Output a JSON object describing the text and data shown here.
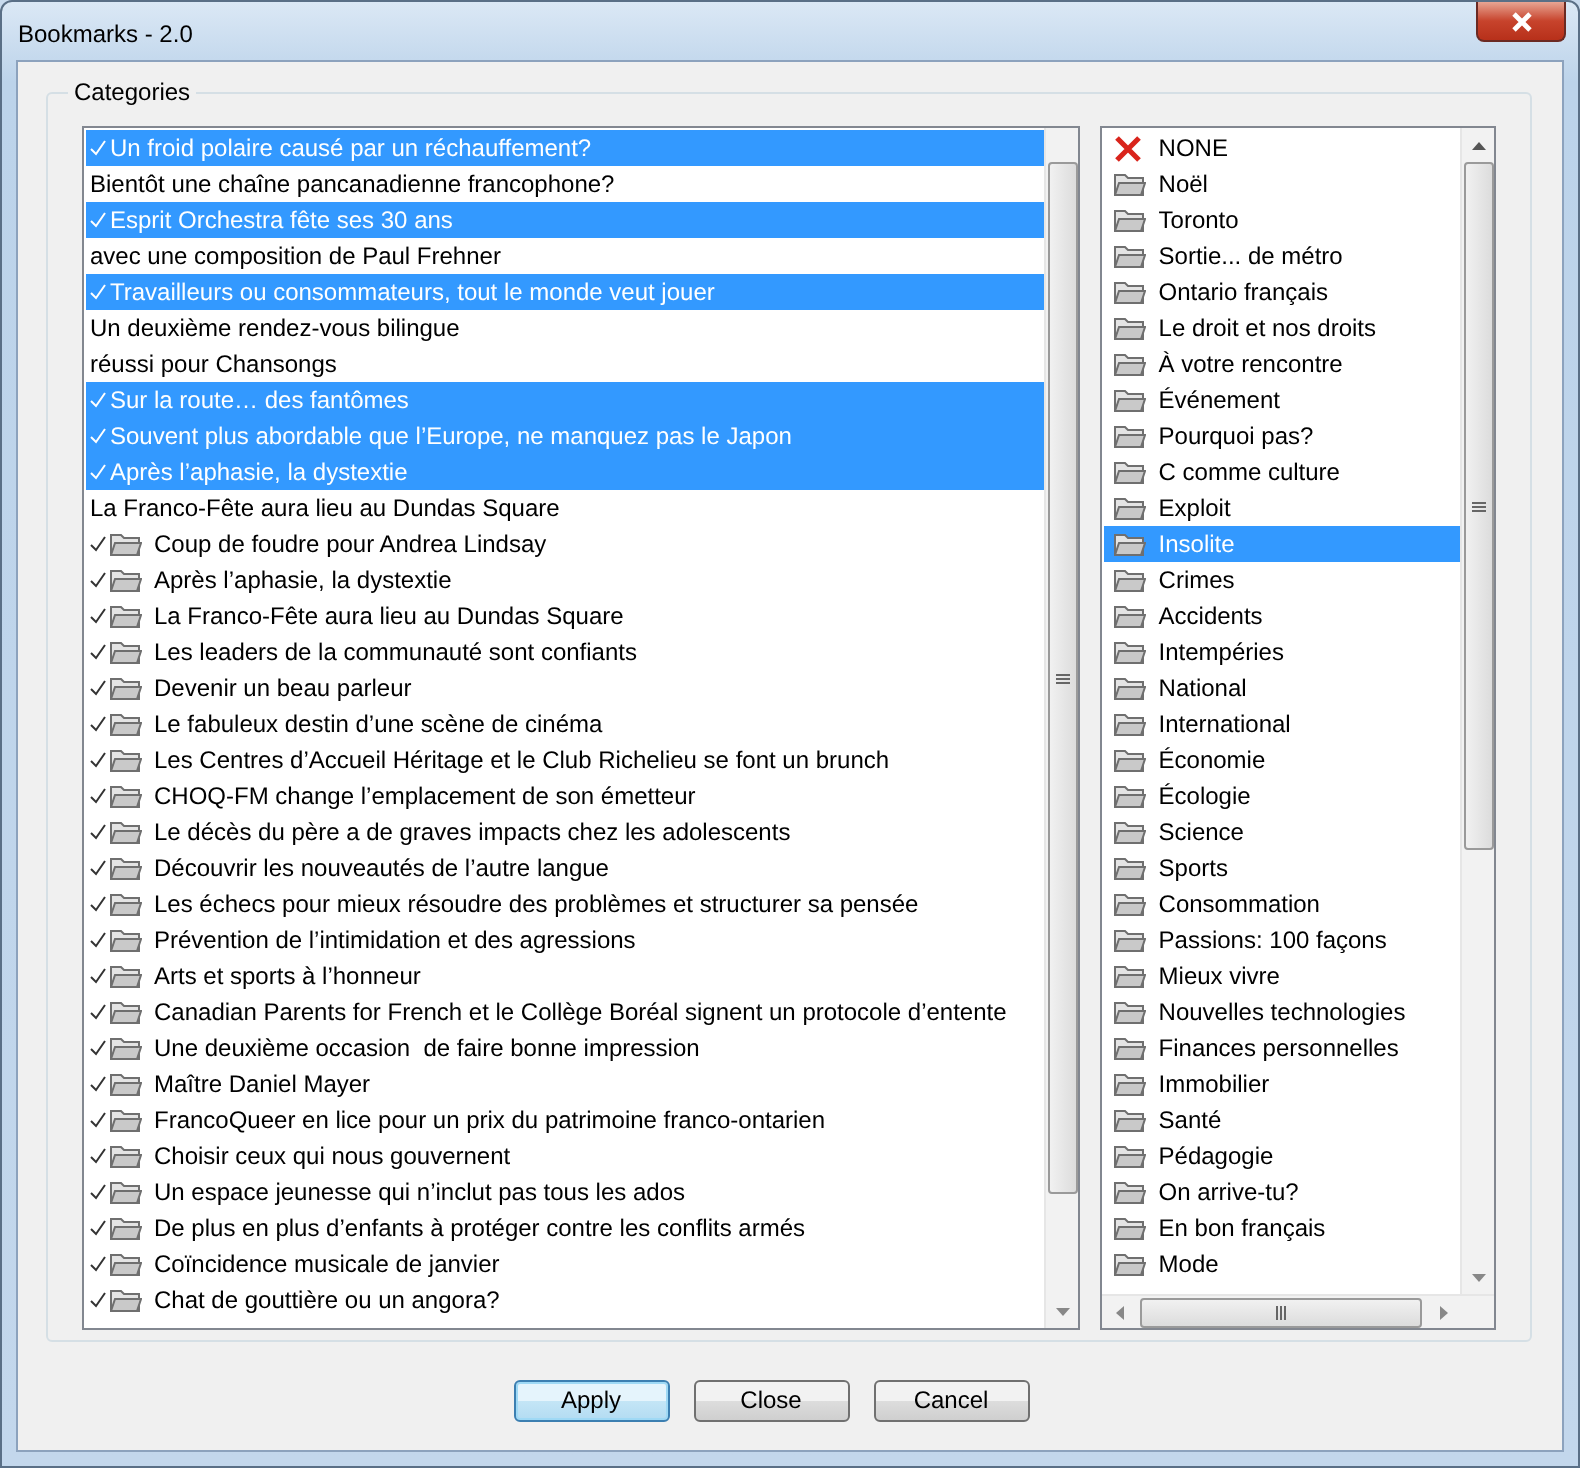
{
  "window": {
    "title": "Bookmarks - 2.0"
  },
  "group": {
    "label": "Categories"
  },
  "bookmarks": [
    {
      "kind": "plain",
      "text": "Un froid polaire causé par un réchauffement?",
      "checked": true,
      "selected": true
    },
    {
      "kind": "plain",
      "text": "Bientôt une chaîne pancanadienne francophone?",
      "checked": false,
      "selected": false
    },
    {
      "kind": "plain",
      "text": "Esprit Orchestra fête ses 30 ans",
      "checked": true,
      "selected": true
    },
    {
      "kind": "plain",
      "text": "avec une composition de Paul Frehner",
      "checked": false,
      "selected": false
    },
    {
      "kind": "plain",
      "text": "Travailleurs ou consommateurs, tout le monde veut jouer",
      "checked": true,
      "selected": true
    },
    {
      "kind": "plain",
      "text": "Un deuxième rendez-vous bilingue",
      "checked": false,
      "selected": false
    },
    {
      "kind": "plain",
      "text": "réussi pour Chansongs",
      "checked": false,
      "selected": false
    },
    {
      "kind": "plain",
      "text": "Sur la route… des fantômes",
      "checked": true,
      "selected": true
    },
    {
      "kind": "plain",
      "text": "Souvent plus abordable que l’Europe, ne manquez pas le Japon",
      "checked": true,
      "selected": true
    },
    {
      "kind": "plain",
      "text": "Après l’aphasie, la dystextie",
      "checked": true,
      "selected": true
    },
    {
      "kind": "plain",
      "text": "La Franco-Fête aura lieu au Dundas Square",
      "checked": false,
      "selected": false
    },
    {
      "kind": "folder",
      "text": "Coup de foudre pour Andrea Lindsay",
      "checked": true,
      "selected": false
    },
    {
      "kind": "folder",
      "text": "Après l’aphasie, la dystextie",
      "checked": true,
      "selected": false
    },
    {
      "kind": "folder",
      "text": "La Franco-Fête aura lieu au Dundas Square",
      "checked": true,
      "selected": false
    },
    {
      "kind": "folder",
      "text": "Les leaders de la communauté sont confiants",
      "checked": true,
      "selected": false
    },
    {
      "kind": "folder",
      "text": "Devenir un beau parleur",
      "checked": true,
      "selected": false
    },
    {
      "kind": "folder",
      "text": "Le fabuleux destin d’une scène de cinéma",
      "checked": true,
      "selected": false
    },
    {
      "kind": "folder",
      "text": "Les Centres d’Accueil Héritage et le Club Richelieu se font un brunch",
      "checked": true,
      "selected": false
    },
    {
      "kind": "folder",
      "text": "CHOQ-FM change l’emplacement de son émetteur",
      "checked": true,
      "selected": false
    },
    {
      "kind": "folder",
      "text": "Le décès du père a de graves impacts chez les adolescents",
      "checked": true,
      "selected": false
    },
    {
      "kind": "folder",
      "text": "Découvrir les nouveautés de l’autre langue",
      "checked": true,
      "selected": false
    },
    {
      "kind": "folder",
      "text": "Les échecs pour mieux résoudre des problèmes et structurer sa pensée",
      "checked": true,
      "selected": false
    },
    {
      "kind": "folder",
      "text": "Prévention de l’intimidation et des agressions",
      "checked": true,
      "selected": false
    },
    {
      "kind": "folder",
      "text": "Arts et sports à l’honneur",
      "checked": true,
      "selected": false
    },
    {
      "kind": "folder",
      "text": "Canadian Parents for French et le Collège Boréal signent un protocole d’entente",
      "checked": true,
      "selected": false
    },
    {
      "kind": "folder",
      "text": "Une deuxième occasion  de faire bonne impression",
      "checked": true,
      "selected": false
    },
    {
      "kind": "folder",
      "text": "Maître Daniel Mayer",
      "checked": true,
      "selected": false
    },
    {
      "kind": "folder",
      "text": "FrancoQueer en lice pour un prix du patrimoine franco-ontarien",
      "checked": true,
      "selected": false
    },
    {
      "kind": "folder",
      "text": "Choisir ceux qui nous gouvernent",
      "checked": true,
      "selected": false
    },
    {
      "kind": "folder",
      "text": "Un espace jeunesse qui n’inclut pas tous les ados",
      "checked": true,
      "selected": false
    },
    {
      "kind": "folder",
      "text": "De plus en plus d’enfants à protéger contre les conflits armés",
      "checked": true,
      "selected": false
    },
    {
      "kind": "folder",
      "text": "Coïncidence musicale de janvier",
      "checked": true,
      "selected": false
    },
    {
      "kind": "folder",
      "text": "Chat de gouttière ou un angora?",
      "checked": true,
      "selected": false
    }
  ],
  "categories": [
    {
      "kind": "none",
      "text": "NONE",
      "selected": false
    },
    {
      "kind": "folder",
      "text": "Noël",
      "selected": false
    },
    {
      "kind": "folder",
      "text": "Toronto",
      "selected": false
    },
    {
      "kind": "folder",
      "text": "Sortie... de métro",
      "selected": false
    },
    {
      "kind": "folder",
      "text": "Ontario français",
      "selected": false
    },
    {
      "kind": "folder",
      "text": "Le droit et nos droits",
      "selected": false
    },
    {
      "kind": "folder",
      "text": "À votre rencontre",
      "selected": false
    },
    {
      "kind": "folder",
      "text": "Événement",
      "selected": false
    },
    {
      "kind": "folder",
      "text": "Pourquoi pas?",
      "selected": false
    },
    {
      "kind": "folder",
      "text": "C comme culture",
      "selected": false
    },
    {
      "kind": "folder",
      "text": "Exploit",
      "selected": false
    },
    {
      "kind": "folder",
      "text": "Insolite",
      "selected": true
    },
    {
      "kind": "folder",
      "text": "Crimes",
      "selected": false
    },
    {
      "kind": "folder",
      "text": "Accidents",
      "selected": false
    },
    {
      "kind": "folder",
      "text": "Intempéries",
      "selected": false
    },
    {
      "kind": "folder",
      "text": "National",
      "selected": false
    },
    {
      "kind": "folder",
      "text": "International",
      "selected": false
    },
    {
      "kind": "folder",
      "text": "Économie",
      "selected": false
    },
    {
      "kind": "folder",
      "text": "Écologie",
      "selected": false
    },
    {
      "kind": "folder",
      "text": "Science",
      "selected": false
    },
    {
      "kind": "folder",
      "text": "Sports",
      "selected": false
    },
    {
      "kind": "folder",
      "text": "Consommation",
      "selected": false
    },
    {
      "kind": "folder",
      "text": "Passions: 100 façons",
      "selected": false
    },
    {
      "kind": "folder",
      "text": "Mieux vivre",
      "selected": false
    },
    {
      "kind": "folder",
      "text": "Nouvelles technologies",
      "selected": false
    },
    {
      "kind": "folder",
      "text": "Finances personnelles",
      "selected": false
    },
    {
      "kind": "folder",
      "text": "Immobilier",
      "selected": false
    },
    {
      "kind": "folder",
      "text": "Santé",
      "selected": false
    },
    {
      "kind": "folder",
      "text": "Pédagogie",
      "selected": false
    },
    {
      "kind": "folder",
      "text": "On arrive-tu?",
      "selected": false
    },
    {
      "kind": "folder",
      "text": "En bon français",
      "selected": false
    },
    {
      "kind": "folder",
      "text": "Mode",
      "selected": false
    }
  ],
  "buttons": [
    {
      "label": "Apply",
      "default": true
    },
    {
      "label": "Close",
      "default": false
    },
    {
      "label": "Cancel",
      "default": false
    }
  ]
}
